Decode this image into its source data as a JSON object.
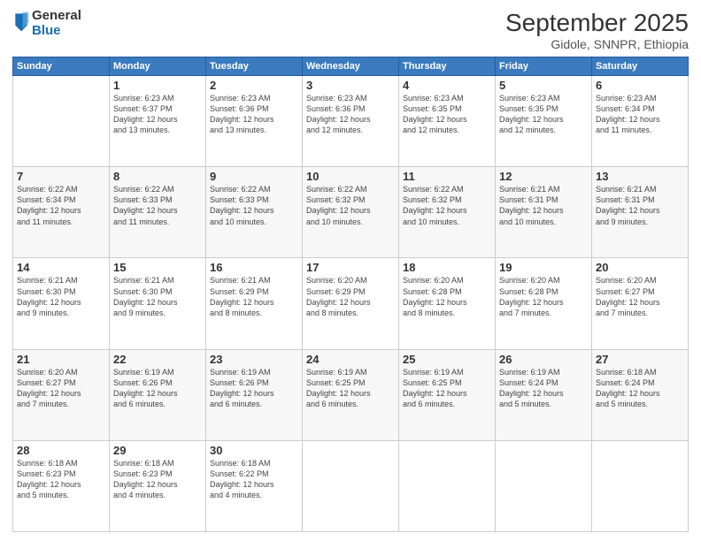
{
  "logo": {
    "general": "General",
    "blue": "Blue"
  },
  "header": {
    "month": "September 2025",
    "location": "Gidole, SNNPR, Ethiopia"
  },
  "days": [
    "Sunday",
    "Monday",
    "Tuesday",
    "Wednesday",
    "Thursday",
    "Friday",
    "Saturday"
  ],
  "weeks": [
    [
      {
        "num": "",
        "info": ""
      },
      {
        "num": "1",
        "info": "Sunrise: 6:23 AM\nSunset: 6:37 PM\nDaylight: 12 hours\nand 13 minutes."
      },
      {
        "num": "2",
        "info": "Sunrise: 6:23 AM\nSunset: 6:36 PM\nDaylight: 12 hours\nand 13 minutes."
      },
      {
        "num": "3",
        "info": "Sunrise: 6:23 AM\nSunset: 6:36 PM\nDaylight: 12 hours\nand 12 minutes."
      },
      {
        "num": "4",
        "info": "Sunrise: 6:23 AM\nSunset: 6:35 PM\nDaylight: 12 hours\nand 12 minutes."
      },
      {
        "num": "5",
        "info": "Sunrise: 6:23 AM\nSunset: 6:35 PM\nDaylight: 12 hours\nand 12 minutes."
      },
      {
        "num": "6",
        "info": "Sunrise: 6:23 AM\nSunset: 6:34 PM\nDaylight: 12 hours\nand 11 minutes."
      }
    ],
    [
      {
        "num": "7",
        "info": "Sunrise: 6:22 AM\nSunset: 6:34 PM\nDaylight: 12 hours\nand 11 minutes."
      },
      {
        "num": "8",
        "info": "Sunrise: 6:22 AM\nSunset: 6:33 PM\nDaylight: 12 hours\nand 11 minutes."
      },
      {
        "num": "9",
        "info": "Sunrise: 6:22 AM\nSunset: 6:33 PM\nDaylight: 12 hours\nand 10 minutes."
      },
      {
        "num": "10",
        "info": "Sunrise: 6:22 AM\nSunset: 6:32 PM\nDaylight: 12 hours\nand 10 minutes."
      },
      {
        "num": "11",
        "info": "Sunrise: 6:22 AM\nSunset: 6:32 PM\nDaylight: 12 hours\nand 10 minutes."
      },
      {
        "num": "12",
        "info": "Sunrise: 6:21 AM\nSunset: 6:31 PM\nDaylight: 12 hours\nand 10 minutes."
      },
      {
        "num": "13",
        "info": "Sunrise: 6:21 AM\nSunset: 6:31 PM\nDaylight: 12 hours\nand 9 minutes."
      }
    ],
    [
      {
        "num": "14",
        "info": "Sunrise: 6:21 AM\nSunset: 6:30 PM\nDaylight: 12 hours\nand 9 minutes."
      },
      {
        "num": "15",
        "info": "Sunrise: 6:21 AM\nSunset: 6:30 PM\nDaylight: 12 hours\nand 9 minutes."
      },
      {
        "num": "16",
        "info": "Sunrise: 6:21 AM\nSunset: 6:29 PM\nDaylight: 12 hours\nand 8 minutes."
      },
      {
        "num": "17",
        "info": "Sunrise: 6:20 AM\nSunset: 6:29 PM\nDaylight: 12 hours\nand 8 minutes."
      },
      {
        "num": "18",
        "info": "Sunrise: 6:20 AM\nSunset: 6:28 PM\nDaylight: 12 hours\nand 8 minutes."
      },
      {
        "num": "19",
        "info": "Sunrise: 6:20 AM\nSunset: 6:28 PM\nDaylight: 12 hours\nand 7 minutes."
      },
      {
        "num": "20",
        "info": "Sunrise: 6:20 AM\nSunset: 6:27 PM\nDaylight: 12 hours\nand 7 minutes."
      }
    ],
    [
      {
        "num": "21",
        "info": "Sunrise: 6:20 AM\nSunset: 6:27 PM\nDaylight: 12 hours\nand 7 minutes."
      },
      {
        "num": "22",
        "info": "Sunrise: 6:19 AM\nSunset: 6:26 PM\nDaylight: 12 hours\nand 6 minutes."
      },
      {
        "num": "23",
        "info": "Sunrise: 6:19 AM\nSunset: 6:26 PM\nDaylight: 12 hours\nand 6 minutes."
      },
      {
        "num": "24",
        "info": "Sunrise: 6:19 AM\nSunset: 6:25 PM\nDaylight: 12 hours\nand 6 minutes."
      },
      {
        "num": "25",
        "info": "Sunrise: 6:19 AM\nSunset: 6:25 PM\nDaylight: 12 hours\nand 6 minutes."
      },
      {
        "num": "26",
        "info": "Sunrise: 6:19 AM\nSunset: 6:24 PM\nDaylight: 12 hours\nand 5 minutes."
      },
      {
        "num": "27",
        "info": "Sunrise: 6:18 AM\nSunset: 6:24 PM\nDaylight: 12 hours\nand 5 minutes."
      }
    ],
    [
      {
        "num": "28",
        "info": "Sunrise: 6:18 AM\nSunset: 6:23 PM\nDaylight: 12 hours\nand 5 minutes."
      },
      {
        "num": "29",
        "info": "Sunrise: 6:18 AM\nSunset: 6:23 PM\nDaylight: 12 hours\nand 4 minutes."
      },
      {
        "num": "30",
        "info": "Sunrise: 6:18 AM\nSunset: 6:22 PM\nDaylight: 12 hours\nand 4 minutes."
      },
      {
        "num": "",
        "info": ""
      },
      {
        "num": "",
        "info": ""
      },
      {
        "num": "",
        "info": ""
      },
      {
        "num": "",
        "info": ""
      }
    ]
  ]
}
